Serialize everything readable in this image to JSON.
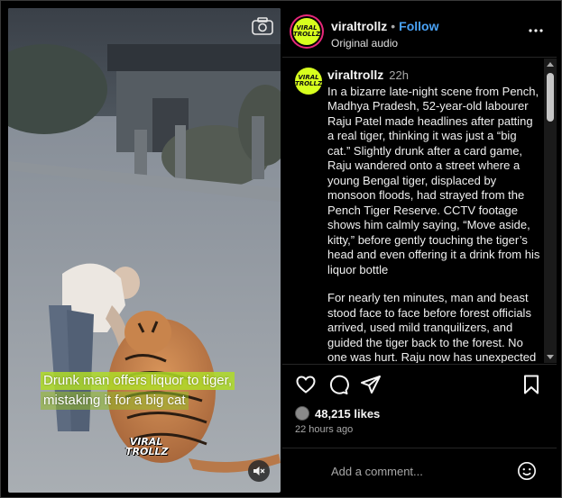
{
  "media": {
    "caption_line1": "Drunk man offers liquor to tiger,",
    "caption_line2": "mistaking it for a big cat",
    "watermark": "VIRAL TROLLZ",
    "camera_icon": "camera-icon",
    "mute_icon": "speaker-muted-icon"
  },
  "header": {
    "username": "viraltrollz",
    "dot": "•",
    "follow_label": "Follow",
    "audio": "Original audio",
    "avatar_text": "VIRAL TROLLZ",
    "more_icon": "more-horizontal-icon"
  },
  "post": {
    "username": "viraltrollz",
    "time": "22h",
    "paragraph1": "In a bizarre late-night scene from Pench, Madhya Pradesh, 52-year-old labourer Raju Patel made headlines after patting a real tiger, thinking it was just a “big cat.” Slightly drunk after a card game, Raju wandered onto a street where a young Bengal tiger, displaced by monsoon floods, had strayed from the Pench Tiger Reserve. CCTV footage shows him calmly saying, “Move aside, kitty,” before gently touching the tiger’s head and even offering it a drink from his liquor bottle",
    "paragraph2": "For nearly ten minutes, man and beast stood face to face before forest officials arrived, used mild tranquilizers, and guided the tiger back to the forest. No one was hurt. Raju now has unexpected"
  },
  "actions": {
    "like_icon": "heart-icon",
    "comment_icon": "comment-icon",
    "share_icon": "send-icon",
    "save_icon": "bookmark-icon"
  },
  "likes": "48,215 likes",
  "time_ago": "22 hours ago",
  "comment_box": {
    "placeholder": "Add a comment...",
    "emoji_icon": "emoji-icon"
  },
  "colors": {
    "background": "#000000",
    "follow": "#4aa3f7",
    "brand_avatar": "#d7ff1e",
    "story_ring": "#e6287a",
    "caption_highlight": "#afdc28"
  }
}
